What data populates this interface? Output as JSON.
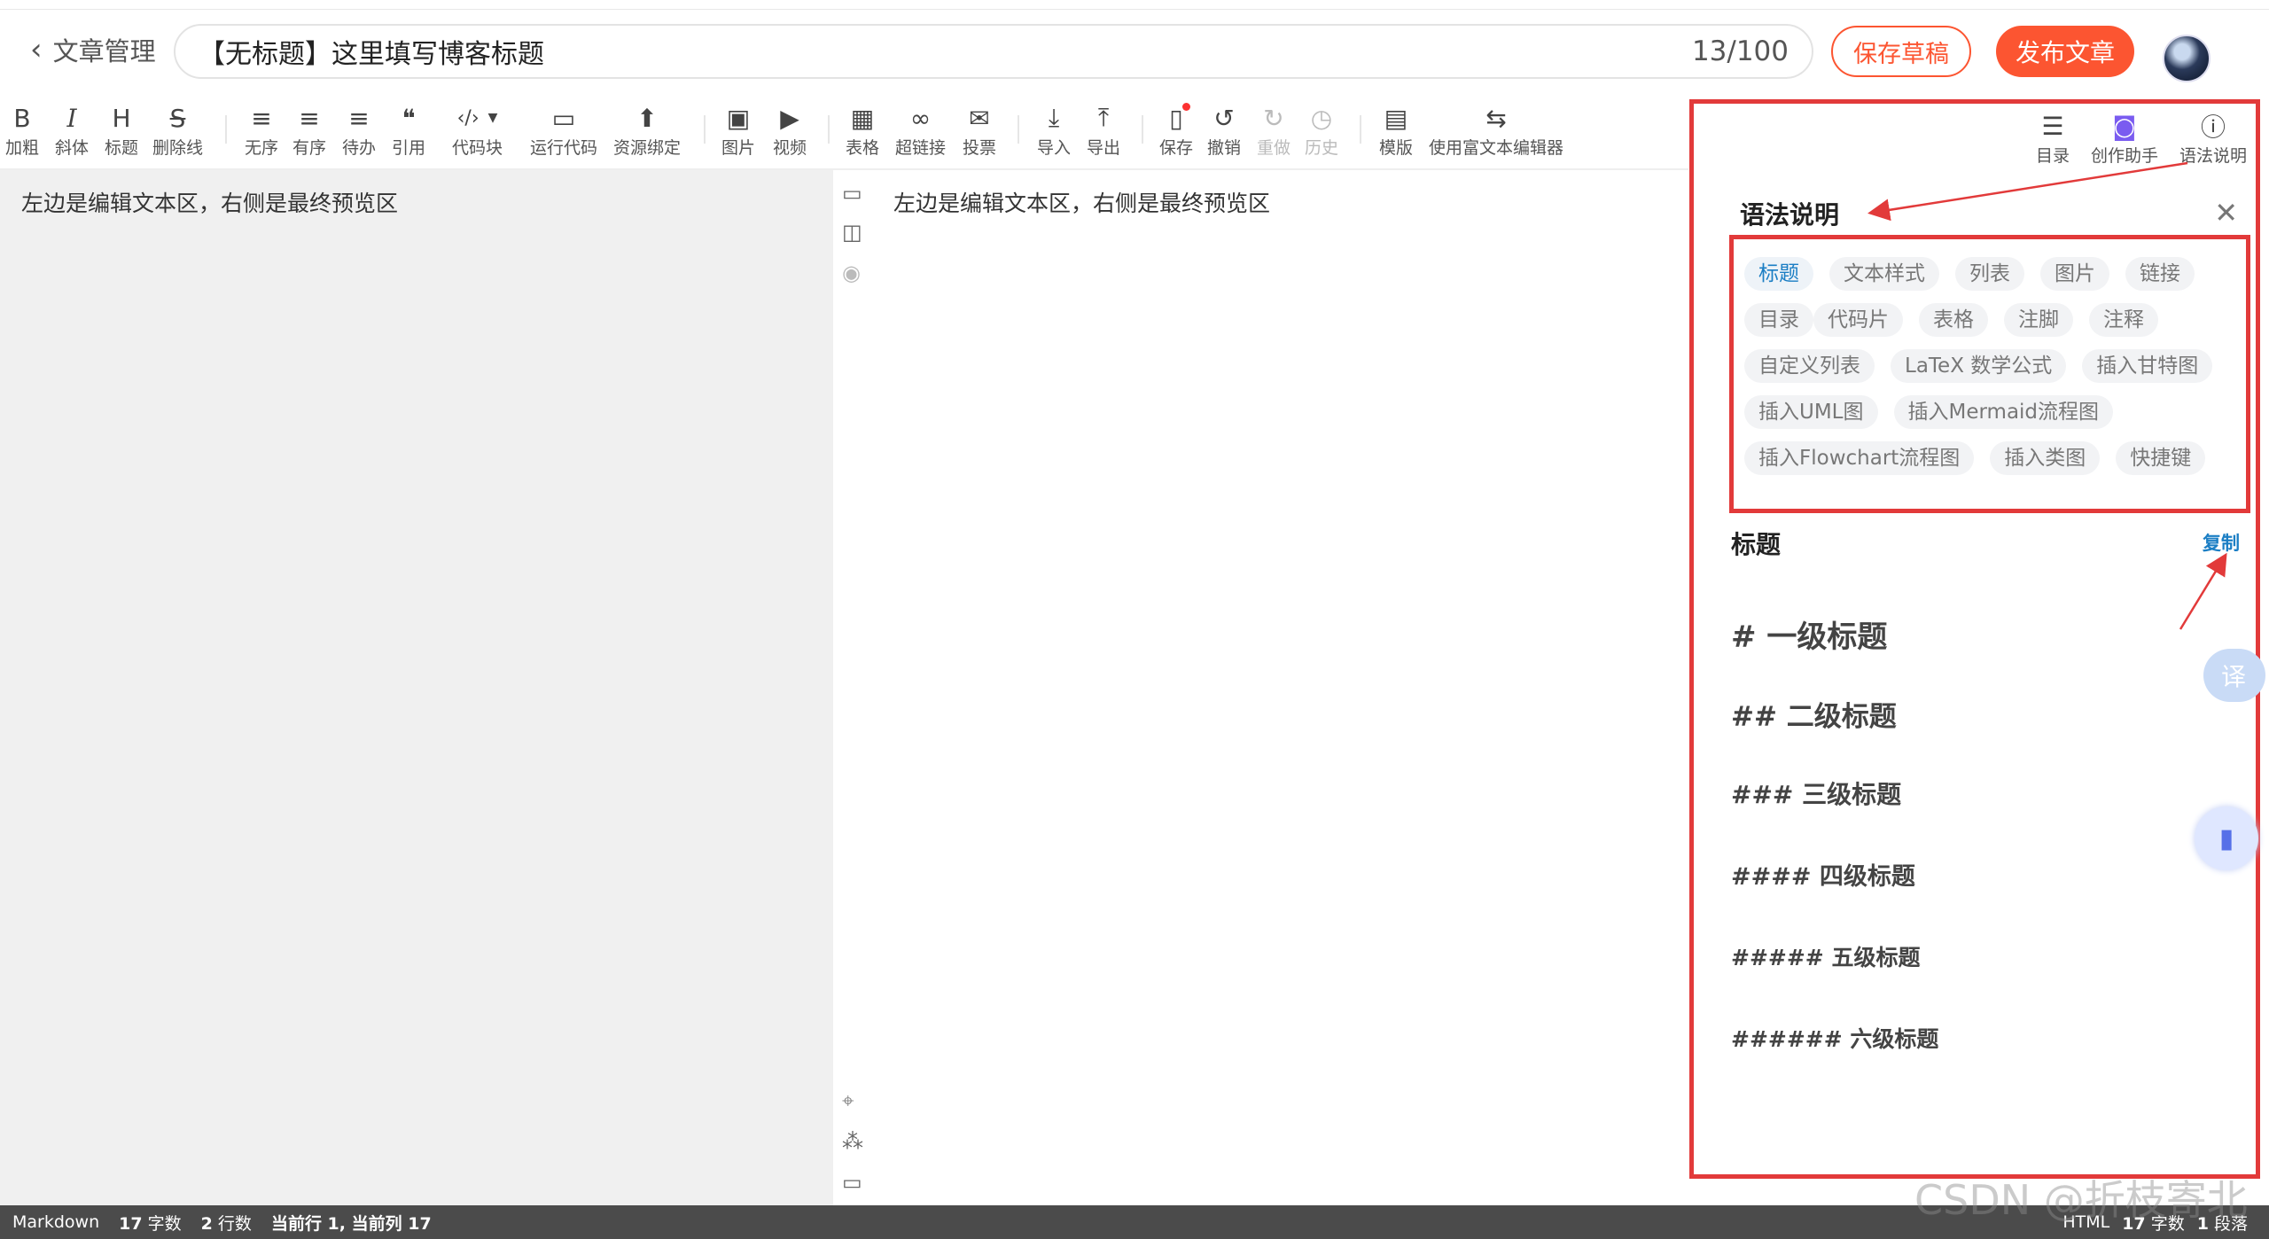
{
  "header": {
    "back_label": "文章管理",
    "title_value": "【无标题】这里填写博客标题",
    "title_count": "13/100",
    "draft_button": "保存草稿",
    "publish_button": "发布文章"
  },
  "toolbar": {
    "items": [
      {
        "icon": "B",
        "label": "加粗"
      },
      {
        "icon": "I",
        "label": "斜体"
      },
      {
        "icon": "H",
        "label": "标题"
      },
      {
        "icon": "S",
        "label": "删除线"
      },
      {
        "icon": "≡",
        "label": "无序"
      },
      {
        "icon": "≡",
        "label": "有序"
      },
      {
        "icon": "≡",
        "label": "待办"
      },
      {
        "icon": "❝",
        "label": "引用"
      },
      {
        "icon": "‹/›",
        "label": "代码块"
      },
      {
        "icon": "▭",
        "label": "运行代码"
      },
      {
        "icon": "⬆",
        "label": "资源绑定"
      },
      {
        "icon": "▣",
        "label": "图片"
      },
      {
        "icon": "▶",
        "label": "视频"
      },
      {
        "icon": "▦",
        "label": "表格"
      },
      {
        "icon": "∞",
        "label": "超链接"
      },
      {
        "icon": "✉",
        "label": "投票"
      },
      {
        "icon": "⤓",
        "label": "导入"
      },
      {
        "icon": "⤒",
        "label": "导出"
      },
      {
        "icon": "▯",
        "label": "保存"
      },
      {
        "icon": "↺",
        "label": "撤销"
      },
      {
        "icon": "↻",
        "label": "重做"
      },
      {
        "icon": "◷",
        "label": "历史"
      },
      {
        "icon": "▤",
        "label": "模版"
      },
      {
        "icon": "⇆",
        "label": "使用富文本编辑器"
      }
    ]
  },
  "editor": {
    "text": "左边是编辑文本区，右侧是最终预览区"
  },
  "preview": {
    "text": "左边是编辑文本区，右侧是最终预览区"
  },
  "panel": {
    "tabs": [
      {
        "label": "目录",
        "icon": "toc-icon"
      },
      {
        "label": "创作助手",
        "icon": "robot-icon"
      },
      {
        "label": "语法说明",
        "icon": "help-icon"
      }
    ],
    "title": "语法说明",
    "tags": [
      "标题",
      "文本样式",
      "列表",
      "图片",
      "链接",
      "目录",
      "代码片",
      "表格",
      "注脚",
      "注释",
      "自定义列表",
      "LaTeX 数学公式",
      "插入甘特图",
      "插入UML图",
      "插入Mermaid流程图",
      "插入Flowchart流程图",
      "插入类图",
      "快捷键"
    ],
    "section_title": "标题",
    "copy_label": "复制",
    "headings": [
      "# 一级标题",
      "## 二级标题",
      "### 三级标题",
      "#### 四级标题",
      "##### 五级标题",
      "###### 六级标题"
    ]
  },
  "floating": {
    "translate_label": "译"
  },
  "status": {
    "mode": "Markdown",
    "chars": "17",
    "chars_unit": "字数",
    "lines": "2",
    "lines_unit": "行数",
    "cursor": "当前行 1, 当前列 17",
    "right_mode": "HTML",
    "right_chars": "17",
    "right_chars_unit": "字数",
    "right_paras": "1",
    "right_paras_unit": "段落"
  },
  "watermark": "CSDN @折枝寄北",
  "colors": {
    "brand": "#fc5531",
    "annotation": "#e23a3a",
    "link": "#1b7ec4"
  }
}
